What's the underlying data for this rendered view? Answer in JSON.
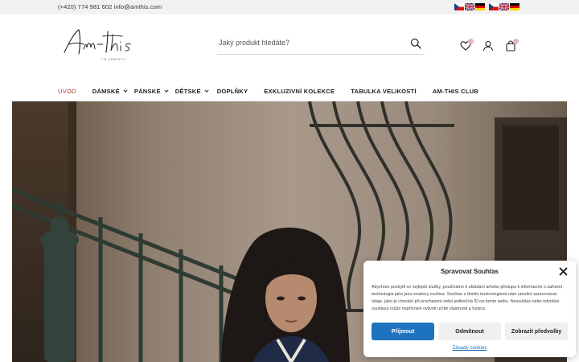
{
  "topbar": {
    "contact": "(+420) 774 981 602  info@amthis.com",
    "languages_group_a": [
      "cs",
      "en",
      "de"
    ],
    "languages_group_b": [
      "cs",
      "en",
      "de"
    ]
  },
  "logo": {
    "text": "Am-this",
    "tagline": "I'M PERFECT"
  },
  "search": {
    "placeholder": "Jaký produkt hledáte?",
    "value": ""
  },
  "header_icons": [
    "heart-icon",
    "user-icon",
    "cart-icon"
  ],
  "nav": {
    "items": [
      {
        "label": "ÚVOD",
        "active": true,
        "dropdown": false
      },
      {
        "label": "DÁMSKÉ",
        "active": false,
        "dropdown": true
      },
      {
        "label": "PÁNSKÉ",
        "active": false,
        "dropdown": true
      },
      {
        "label": "DĚTSKÉ",
        "active": false,
        "dropdown": true
      },
      {
        "label": "DOPLŇKY",
        "active": false,
        "dropdown": false
      },
      {
        "label": "EXKLUZIVNÍ KOLEKCE",
        "active": false,
        "dropdown": false
      },
      {
        "label": "TABULKA VELIKOSTÍ",
        "active": false,
        "dropdown": false
      },
      {
        "label": "AM-THIS CLUB",
        "active": false,
        "dropdown": false
      }
    ]
  },
  "cookie": {
    "title": "Spravovat Souhlas",
    "text": "Abychom poskytli co nejlepší služby, používáme k ukládání a/nebo přístupu k informacím o zařízení, technologie jako jsou soubory cookies. Souhlas s těmito technologiemi nám umožní zpracovávat údaje, jako je chování při procházení nebo jedinečná ID na tomto webu. Nesouhlas nebo odvolání souhlasu může nepříznivě ovlivnit určité vlastnosti a funkce.",
    "accept_label": "Přijmout",
    "deny_label": "Odmítnout",
    "prefs_label": "Zobrazit předvolby",
    "policy_link": "Zásady cookies"
  },
  "colors": {
    "accent": "#1e73be",
    "nav_active": "#c0392b",
    "badge": "#e8b4bf",
    "topbar_bg": "#f2f2f2"
  }
}
